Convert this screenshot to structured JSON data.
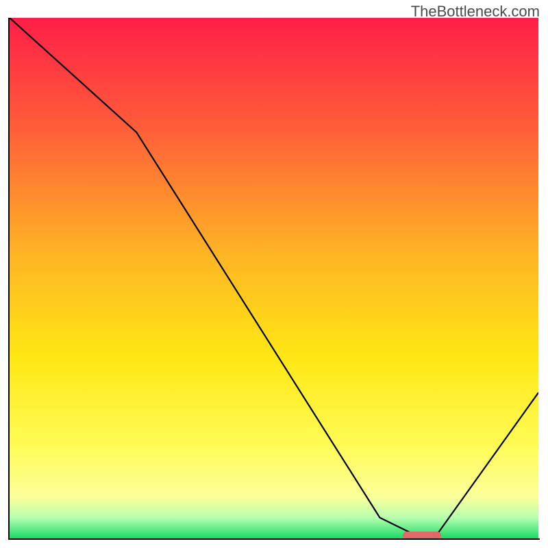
{
  "watermark": "TheBottleneck.com",
  "chart_data": {
    "type": "line",
    "title": "",
    "xlabel": "",
    "ylabel": "",
    "xlim": [
      0,
      100
    ],
    "ylim": [
      0,
      100
    ],
    "series": [
      {
        "name": "bottleneck-curve",
        "x": [
          0,
          24,
          70,
          76,
          81,
          100
        ],
        "values": [
          100,
          78,
          4,
          1,
          1,
          28
        ]
      }
    ],
    "annotations": [
      {
        "name": "optimal-marker",
        "x": 78,
        "y": 0.5,
        "color": "#e06868"
      }
    ],
    "background_gradient": {
      "stops": [
        {
          "pct": 0,
          "color": "#ff1f48"
        },
        {
          "pct": 20,
          "color": "#ff5a3a"
        },
        {
          "pct": 45,
          "color": "#ffb325"
        },
        {
          "pct": 65,
          "color": "#ffe714"
        },
        {
          "pct": 82,
          "color": "#fffb55"
        },
        {
          "pct": 92,
          "color": "#fbff9a"
        },
        {
          "pct": 96,
          "color": "#b8ffb0"
        },
        {
          "pct": 100,
          "color": "#1adb66"
        }
      ]
    }
  }
}
